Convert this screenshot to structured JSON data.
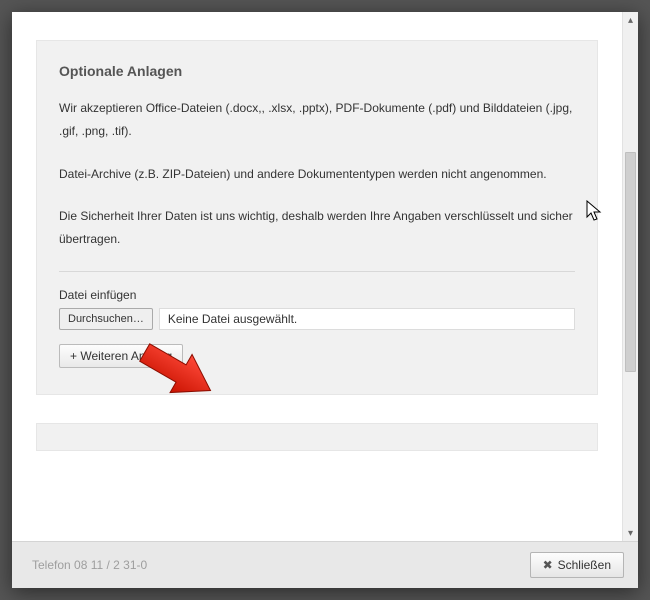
{
  "panel": {
    "heading": "Optionale Anlagen",
    "para1": "Wir akzeptieren Office-Dateien (.docx,, .xlsx, .pptx), PDF-Dokumente (.pdf) und Bilddateien (.jpg, .gif, .png, .tif).",
    "para2": "Datei-Archive (z.B. ZIP-Dateien) und andere Dokumententypen werden nicht angenommen.",
    "para3": "Die Sicherheit Ihrer Daten ist uns wichtig, deshalb werden Ihre Angaben verschlüsselt und sicher übertragen.",
    "file_label": "Datei einfügen",
    "browse_label": "Durchsuchen…",
    "file_status": "Keine Datei ausgewählt.",
    "add_label": "+ Weiteren Anhang"
  },
  "footer": {
    "ghost_text": "Telefon 08 11 / 2 31-0",
    "close_label": "Schließen"
  }
}
